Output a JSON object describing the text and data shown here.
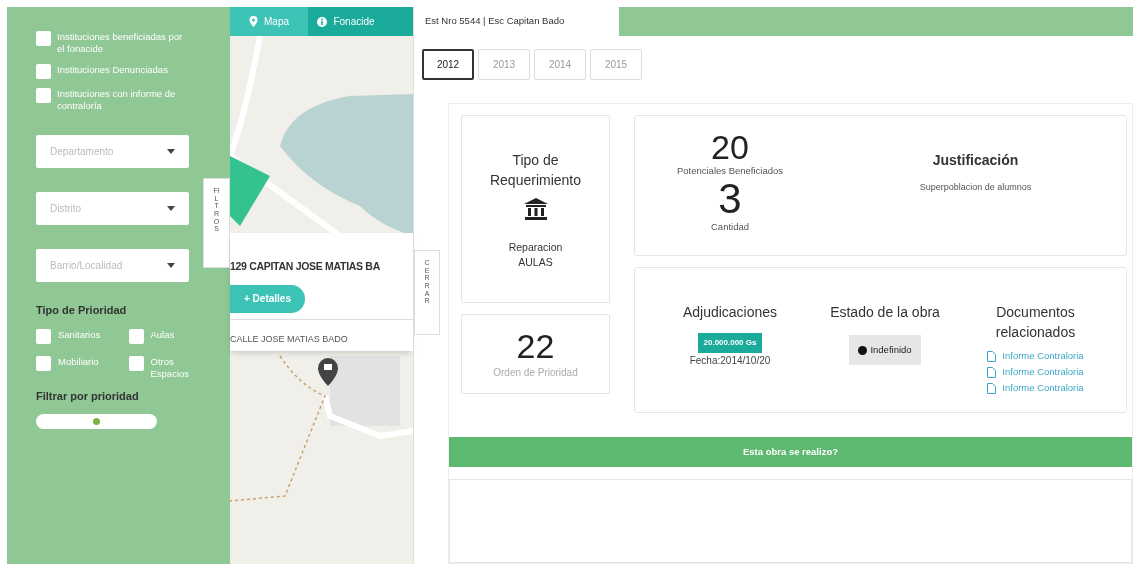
{
  "sidebar": {
    "checks": [
      {
        "label": "Instituciones beneficiadas por el fonacide",
        "checked": false
      },
      {
        "label": "Instituciones Denunciadas",
        "checked": false
      },
      {
        "label": "Instituciones con informe de contraloría",
        "checked": false
      }
    ],
    "selects": [
      {
        "placeholder": "Departamento"
      },
      {
        "placeholder": "Distrito"
      },
      {
        "placeholder": "Barrio/Localidad"
      }
    ],
    "priority_title": "Tipo de Prioridad",
    "priority_checks": [
      {
        "label": "Sanitarios",
        "checked": false
      },
      {
        "label": "Aulas",
        "checked": false
      },
      {
        "label": "Mobiliario",
        "checked": false
      },
      {
        "label": "Otros Espacios",
        "checked": false
      }
    ],
    "filter_title": "Filtrar por prioridad",
    "slider": {
      "level": 0.5
    },
    "toggle_tab": "FILTROS"
  },
  "map": {
    "tabs": [
      {
        "label": "Mapa",
        "kind": "pin",
        "selected": true
      },
      {
        "label": "Fonacide",
        "kind": "info",
        "selected": false
      }
    ],
    "popup": {
      "title": "129 CAPITAN JOSE MATIAS BA",
      "button": "+ Detalles",
      "address": "CALLE JOSE MATIAS BADO"
    },
    "close_tab": "CERRAR"
  },
  "detail": {
    "tab": "Est Nro 5544 | Esc Capitan Bado",
    "years": [
      {
        "label": "2012",
        "selected": true
      },
      {
        "label": "2013",
        "selected": false
      },
      {
        "label": "2014",
        "selected": false
      },
      {
        "label": "2015",
        "selected": false
      }
    ],
    "requirement": {
      "title": "Tipo de Requerimiento",
      "value": "Reparacion AULAS"
    },
    "priority": {
      "value": "22",
      "label": "Orden de Prioridad"
    },
    "beneficiaries": {
      "value": "20",
      "label": "Potenciales Beneficiados"
    },
    "quantity": {
      "value": "3",
      "label": "Cantidad"
    },
    "justification": {
      "title": "Justificación",
      "text": "Superpoblacion de alumnos"
    },
    "awards": {
      "title": "Adjudicaciones",
      "amount": "20.000.000 Gs",
      "date": "Fecha:2014/10/20"
    },
    "status": {
      "title": "Estado de la obra",
      "value": "Indefinido",
      "color": "#111111"
    },
    "documents": {
      "title": "Documentos relacionados",
      "links": [
        "Informe Contraloria",
        "Informe Contraloria",
        "Informe Contraloria"
      ]
    },
    "question": "Esta obra se realizo?"
  }
}
